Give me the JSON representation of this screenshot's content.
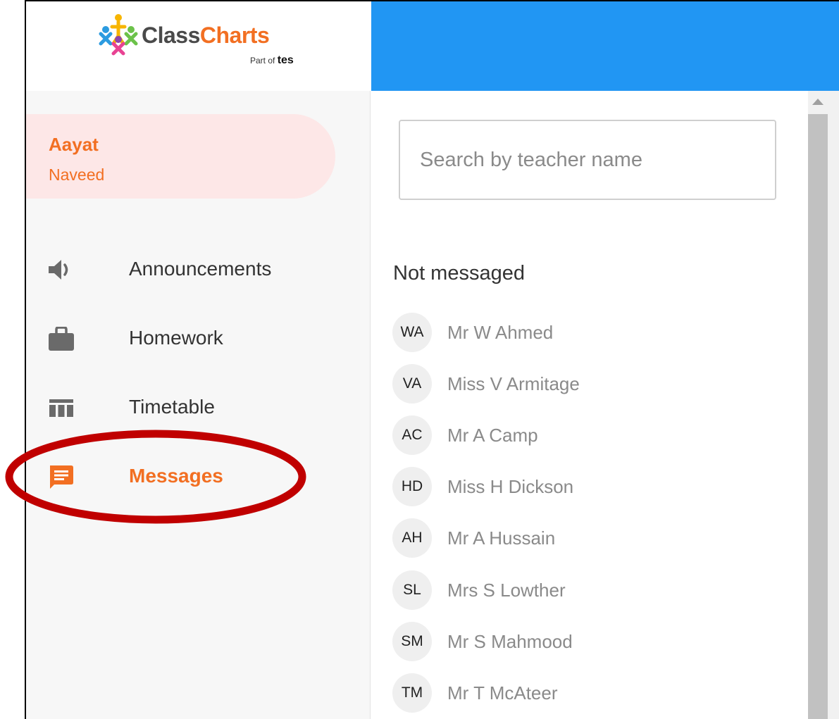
{
  "brand": {
    "name_part1": "Class",
    "name_part2": "Charts",
    "tagline_prefix": "Part of",
    "tagline_brand": "tes"
  },
  "user": {
    "first_name": "Aayat",
    "last_name": "Naveed"
  },
  "nav": [
    {
      "label": "Announcements",
      "icon": "megaphone-icon",
      "active": false
    },
    {
      "label": "Homework",
      "icon": "briefcase-icon",
      "active": false
    },
    {
      "label": "Timetable",
      "icon": "timetable-icon",
      "active": false
    },
    {
      "label": "Messages",
      "icon": "message-icon",
      "active": true
    }
  ],
  "search": {
    "placeholder": "Search by teacher name"
  },
  "section_title": "Not messaged",
  "teachers": [
    {
      "initials": "WA",
      "name": "Mr W Ahmed"
    },
    {
      "initials": "VA",
      "name": "Miss V Armitage"
    },
    {
      "initials": "AC",
      "name": "Mr A Camp"
    },
    {
      "initials": "HD",
      "name": "Miss H Dickson"
    },
    {
      "initials": "AH",
      "name": "Mr A Hussain"
    },
    {
      "initials": "SL",
      "name": "Mrs S Lowther"
    },
    {
      "initials": "SM",
      "name": "Mr S Mahmood"
    },
    {
      "initials": "TM",
      "name": "Mr T McAteer"
    }
  ],
  "colors": {
    "accent": "#f26f22",
    "topbar": "#2196f3",
    "user_card": "#fde7e7",
    "annotation": "#c00000"
  }
}
